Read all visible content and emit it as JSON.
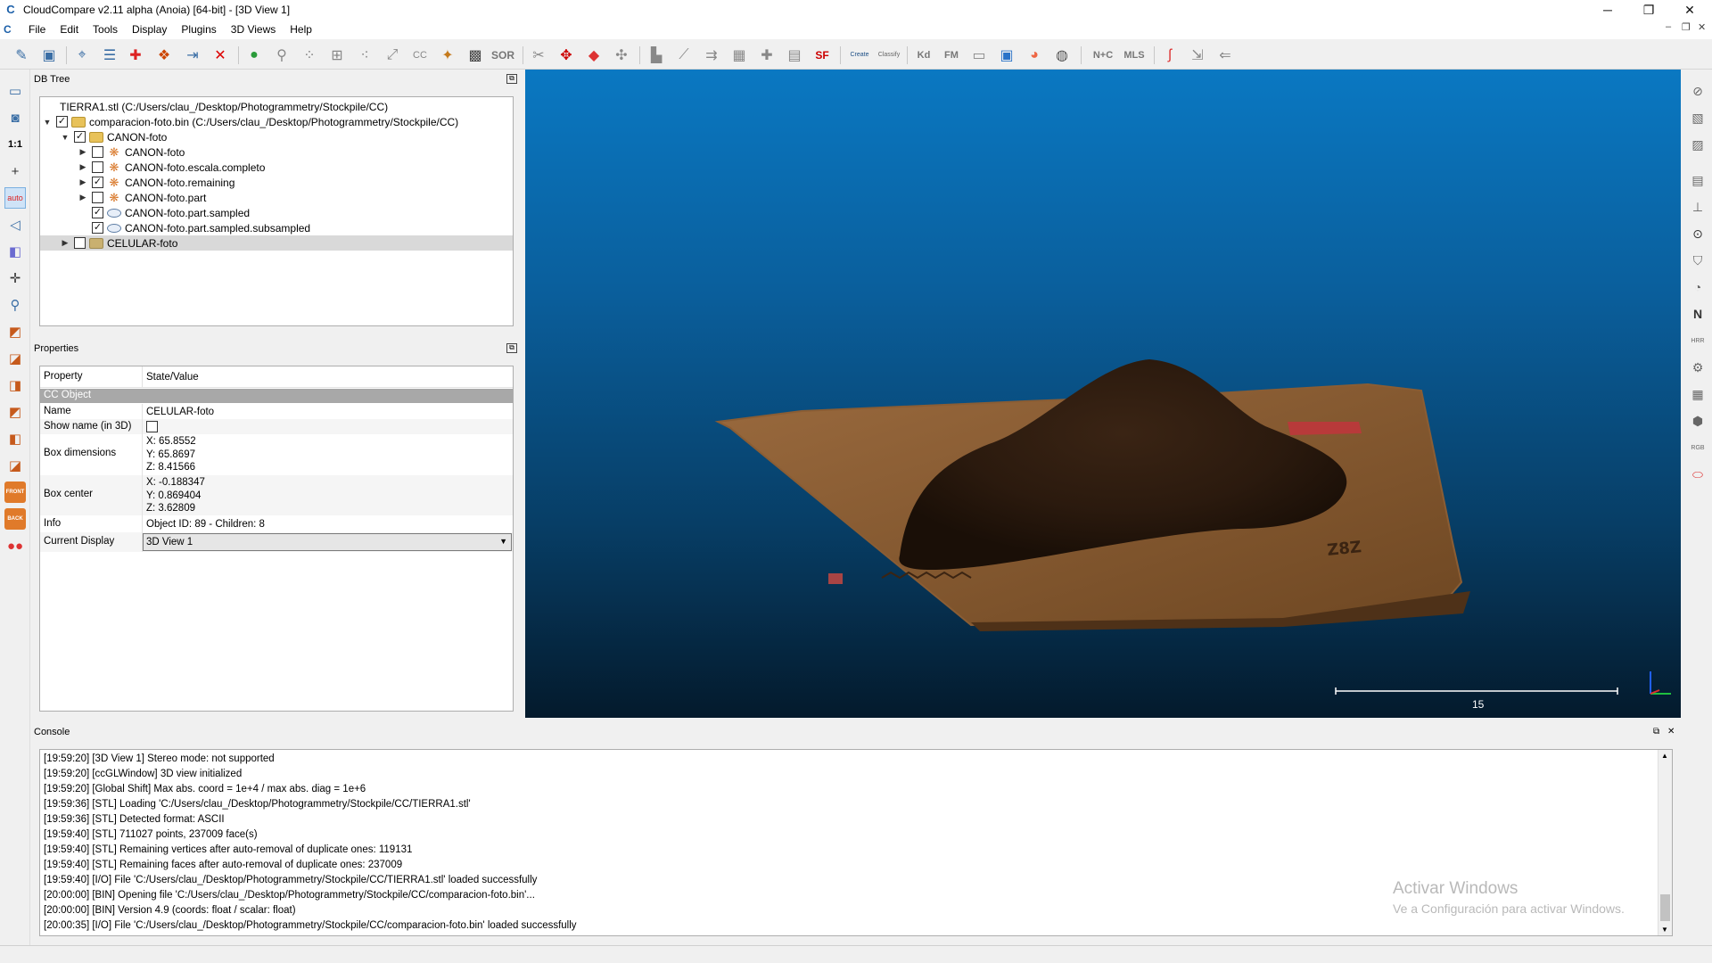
{
  "window": {
    "title": "CloudCompare v2.11 alpha (Anoia) [64-bit] - [3D View 1]",
    "app_icon": "C",
    "minimize": "─",
    "restore": "❐",
    "close": "✕",
    "mdi_minimize": "–",
    "mdi_restore": "❐",
    "mdi_close": "✕"
  },
  "menu": [
    "File",
    "Edit",
    "Tools",
    "Display",
    "Plugins",
    "3D Views",
    "Help"
  ],
  "toolbar": {
    "sf_label": "SF",
    "sor_label": "SOR",
    "cc_label": "CC",
    "kd_label": "Kd",
    "fm_label": "FM",
    "nc_label": "N+C",
    "mls_label": "MLS",
    "canupo1": "Create",
    "canupo2": "Classify"
  },
  "left_toolbar": {
    "one_to_one": "1:1",
    "auto": "auto",
    "front": "FRONT",
    "back": "BACK"
  },
  "right_toolbar": {
    "n_label": "N",
    "hrr": "HRR",
    "rgb": "RGB"
  },
  "dbtree": {
    "header": "DB Tree",
    "items": [
      {
        "label": "TIERRA1.stl (C:/Users/clau_/Desktop/Photogrammetry/Stockpile/CC)",
        "checked": ""
      },
      {
        "label": "comparacion-foto.bin (C:/Users/clau_/Desktop/Photogrammetry/Stockpile/CC)",
        "checked": "✓"
      },
      {
        "label": "CANON-foto",
        "checked": "✓"
      },
      {
        "label": "CANON-foto",
        "checked": ""
      },
      {
        "label": "CANON-foto.escala.completo",
        "checked": ""
      },
      {
        "label": "CANON-foto.remaining",
        "checked": "✓"
      },
      {
        "label": "CANON-foto.part",
        "checked": ""
      },
      {
        "label": "CANON-foto.part.sampled",
        "checked": "✓"
      },
      {
        "label": "CANON-foto.part.sampled.subsampled",
        "checked": "✓"
      },
      {
        "label": "CELULAR-foto",
        "checked": ""
      }
    ]
  },
  "properties": {
    "header": "Properties",
    "col_property": "Property",
    "col_value": "State/Value",
    "section": "CC Object",
    "name_label": "Name",
    "name_value": "CELULAR-foto",
    "show_name_label": "Show name (in 3D)",
    "box_dim_label": "Box dimensions",
    "box_dim_x": "X: 65.8552",
    "box_dim_y": "Y: 65.8697",
    "box_dim_z": "Z: 8.41566",
    "box_center_label": "Box center",
    "box_center_x": "X: -0.188347",
    "box_center_y": "Y: 0.869404",
    "box_center_z": "Z: 3.62809",
    "info_label": "Info",
    "info_value": "Object ID: 89 - Children: 8",
    "display_label": "Current Display",
    "display_value": "3D View 1"
  },
  "view3d": {
    "scale_label": "15"
  },
  "console": {
    "header": "Console",
    "lines": [
      "[19:59:20] [3D View 1] Stereo mode: not supported",
      "[19:59:20] [ccGLWindow] 3D view initialized",
      "[19:59:20] [Global Shift] Max abs. coord = 1e+4 / max abs. diag = 1e+6",
      "[19:59:36] [STL] Loading 'C:/Users/clau_/Desktop/Photogrammetry/Stockpile/CC/TIERRA1.stl'",
      "[19:59:36] [STL] Detected format: ASCII",
      "[19:59:40] [STL] 711027 points, 237009 face(s)",
      "[19:59:40] [STL] Remaining vertices after auto-removal of duplicate ones: 119131",
      "[19:59:40] [STL] Remaining faces after auto-removal of duplicate ones: 237009",
      "[19:59:40] [I/O] File 'C:/Users/clau_/Desktop/Photogrammetry/Stockpile/CC/TIERRA1.stl' loaded successfully",
      "[20:00:00] [BIN] Opening file 'C:/Users/clau_/Desktop/Photogrammetry/Stockpile/CC/comparacion-foto.bin'...",
      "[20:00:00] [BIN] Version 4.9 (coords: float / scalar: float)",
      "[20:00:35] [I/O] File 'C:/Users/clau_/Desktop/Photogrammetry/Stockpile/CC/comparacion-foto.bin' loaded successfully"
    ]
  },
  "watermark": {
    "line1": "Activar Windows",
    "line2": "Ve a Configuración para activar Windows."
  }
}
